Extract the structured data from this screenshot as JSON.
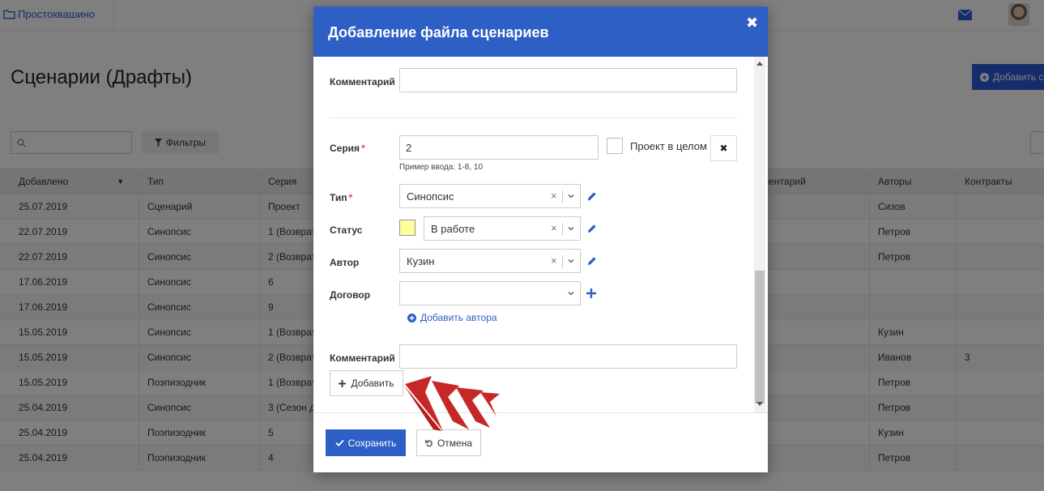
{
  "header": {
    "brand": "Простоквашино",
    "icons": [
      "folder-icon",
      "mail-icon",
      "avatar"
    ]
  },
  "page": {
    "title": "Сценарии (Драфты)",
    "add_button": "Добавить с",
    "filters_button": "Фильтры"
  },
  "table": {
    "columns": {
      "added": "Добавлено",
      "type": "Тип",
      "series": "Серия",
      "comment": "ментарий",
      "authors": "Авторы",
      "contracts": "Контракты"
    },
    "rows": [
      {
        "added": "25.07.2019",
        "type": "Сценарий",
        "series": "Проект",
        "authors": "Сизов",
        "contracts": ""
      },
      {
        "added": "22.07.2019",
        "type": "Синопсис",
        "series": "1 (Возврат",
        "authors": "Петров",
        "contracts": ""
      },
      {
        "added": "22.07.2019",
        "type": "Синопсис",
        "series": "2 (Возврат",
        "authors": "Петров",
        "contracts": ""
      },
      {
        "added": "17.06.2019",
        "type": "Синопсис",
        "series": "6",
        "authors": "",
        "contracts": ""
      },
      {
        "added": "17.06.2019",
        "type": "Синопсис",
        "series": "9",
        "authors": "",
        "contracts": ""
      },
      {
        "added": "15.05.2019",
        "type": "Синопсис",
        "series": "1 (Возврат",
        "authors": "Кузин",
        "contracts": ""
      },
      {
        "added": "15.05.2019",
        "type": "Синопсис",
        "series": "2 (Возврат",
        "authors": "Иванов",
        "contracts": "3"
      },
      {
        "added": "15.05.2019",
        "type": "Поэпизодник",
        "series": "1 (Возврат",
        "authors": "Петров",
        "contracts": ""
      },
      {
        "added": "25.04.2019",
        "type": "Синопсис",
        "series": "3 (Сезон д",
        "authors": "Петров",
        "contracts": ""
      },
      {
        "added": "25.04.2019",
        "type": "Поэпизодник",
        "series": "5",
        "authors": "Кузин",
        "contracts": ""
      },
      {
        "added": "25.04.2019",
        "type": "Поэпизодник",
        "series": "4",
        "authors": "Петров",
        "contracts": ""
      }
    ]
  },
  "modal": {
    "title": "Добавление файла сценариев",
    "close": "✖",
    "comment_top_label": "Комментарий",
    "comment_top_value": "",
    "series_label": "Серия",
    "required_mark": "*",
    "series_value": "2",
    "series_hint": "Пример ввода: 1-8, 10",
    "whole_project_label": "Проект в целом",
    "clear_button": "✖",
    "type_label": "Тип",
    "type_value": "Синопсис",
    "status_label": "Статус",
    "status_value": "В работе",
    "status_color": "#ffff99",
    "author_label": "Автор",
    "author_value": "Кузин",
    "contract_label": "Договор",
    "contract_value": "",
    "add_author": "Добавить автора",
    "comment_label": "Комментарий",
    "comment_value": "",
    "add_button": "Добавить",
    "save_button": "Сохранить",
    "cancel_button": "Отмена",
    "accent_color": "#2d5fc5"
  }
}
